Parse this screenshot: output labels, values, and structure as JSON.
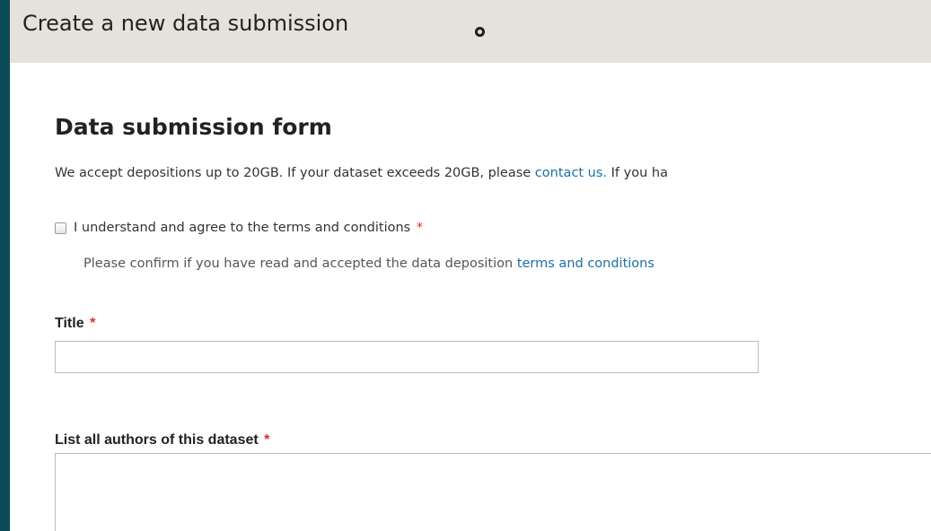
{
  "header": {
    "title": "Create a new data submission",
    "icon": "circle-dot-icon"
  },
  "form": {
    "heading": "Data submission form",
    "intro": {
      "before_link": "We accept depositions up to 20GB. If your dataset exceeds 20GB, please ",
      "link": "contact us.",
      "after_link": " If you ha"
    },
    "terms": {
      "label": "I understand and agree to the terms and conditions",
      "required_marker": "*",
      "desc_before_link": "Please confirm if you have read and accepted the data deposition ",
      "desc_link": "terms and conditions",
      "checked": false
    },
    "title_field": {
      "label": "Title",
      "required_marker": "*",
      "value": "",
      "placeholder": ""
    },
    "authors_field": {
      "label": "List all authors of this dataset",
      "required_marker": "*",
      "value": "",
      "placeholder": ""
    }
  },
  "colors": {
    "outer_background": "#0b4a57",
    "titlebar_background": "#e4e2db",
    "link": "#1d6fa5",
    "required": "#d9302c"
  }
}
